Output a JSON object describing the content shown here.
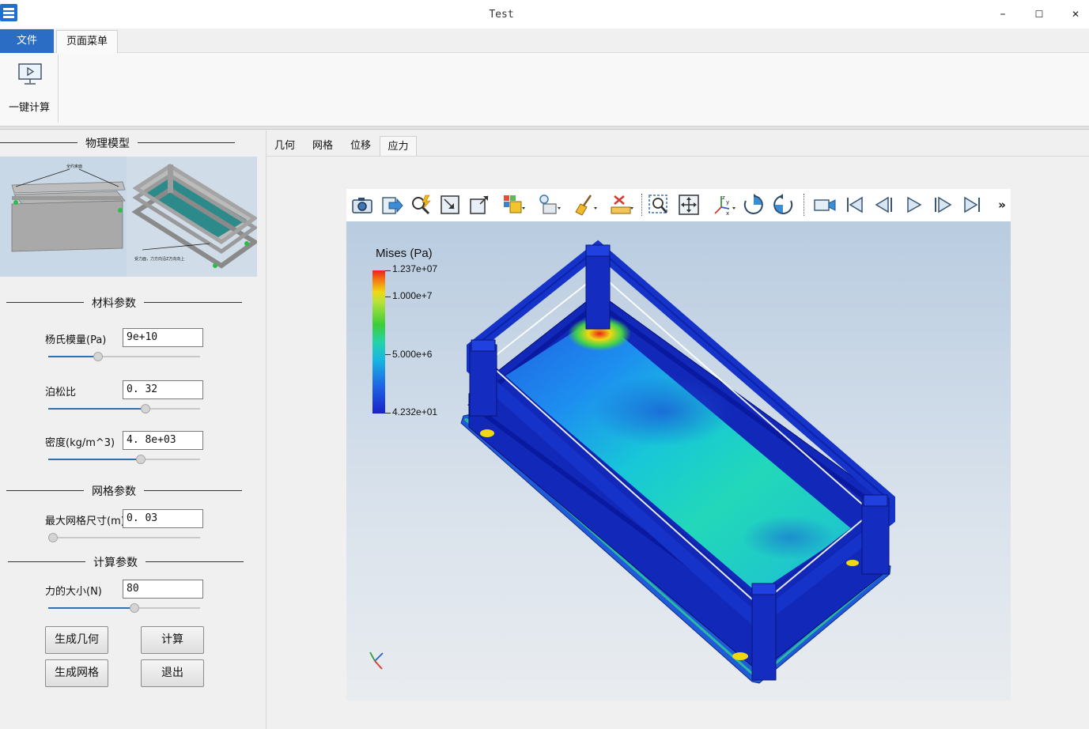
{
  "window": {
    "title": "Test",
    "minimize": "–",
    "maximize": "☐",
    "close": "✕"
  },
  "menu": {
    "file": "文件",
    "page_menu": "页面菜单"
  },
  "ribbon": {
    "one_click_compute": "一键计算"
  },
  "left_panel": {
    "physical_model_title": "物理模型",
    "thumbnail_text": {
      "top_note": "全约束面",
      "bottom_note": "受力面，力方向沿Z方向向上"
    },
    "material_title": "材料参数",
    "youngs_modulus": {
      "label": "杨氏模量(Pa)",
      "value": "9e+10",
      "slider_fraction": 0.33
    },
    "poisson_ratio": {
      "label": "泊松比",
      "value": "0. 32",
      "slider_fraction": 0.64
    },
    "density": {
      "label": "密度(kg/m^3)",
      "value": "4. 8e+03",
      "slider_fraction": 0.61
    },
    "mesh_title": "网格参数",
    "max_mesh_size": {
      "label": "最大网格尺寸(m)",
      "value": "0. 03",
      "slider_fraction": 0.03
    },
    "compute_title": "计算参数",
    "force": {
      "label": "力的大小(N)",
      "value": "80",
      "slider_fraction": 0.57
    },
    "buttons": {
      "generate_geometry": "生成几何",
      "compute": "计算",
      "generate_mesh": "生成网格",
      "exit": "退出"
    }
  },
  "view_tabs": [
    {
      "label": "几何",
      "active": false
    },
    {
      "label": "网格",
      "active": false
    },
    {
      "label": "位移",
      "active": false
    },
    {
      "label": "应力",
      "active": true
    }
  ],
  "toolbar": {
    "icons": [
      "camera-icon",
      "export-icon",
      "query-icon",
      "reset-zoom-icon",
      "maximize-icon",
      "representation-icon",
      "lighting-icon",
      "clear-icon",
      "ruler-icon",
      "zoom-box-icon",
      "zoom-fit-icon",
      "axes-icon",
      "rotate-cw-icon",
      "rotate-ccw-icon",
      "camera-record-icon",
      "first-frame-icon",
      "prev-frame-icon",
      "play-icon",
      "next-frame-icon",
      "last-frame-icon"
    ],
    "more": "»"
  },
  "legend": {
    "title": "Mises (Pa)",
    "max": "1.237e+07",
    "mid_high": "1.000e+7",
    "mid": "5.000e+6",
    "min": "4.232e+01",
    "colors": [
      "#e8221d",
      "#f0d714",
      "#3ccd38",
      "#26d3a8",
      "#1e68e6",
      "#1b20c8"
    ]
  }
}
